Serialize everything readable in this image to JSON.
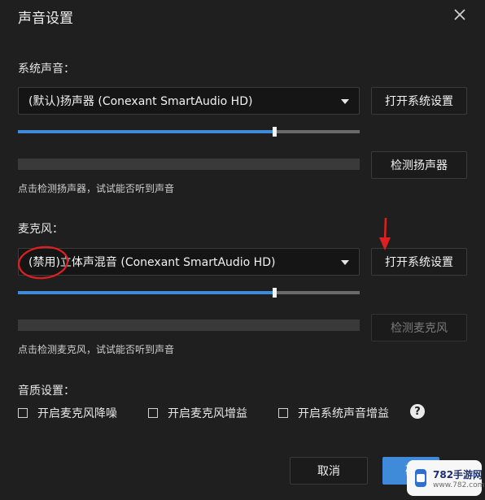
{
  "dialog": {
    "title": "声音设置"
  },
  "speaker": {
    "label": "系统声音：",
    "selected": "(默认)扬声器 (Conexant SmartAudio HD)",
    "open_settings": "打开系统设置",
    "volume": 0.75,
    "test_button": "检测扬声器",
    "hint": "点击检测扬声器，试试能否听到声音"
  },
  "mic": {
    "label": "麦克风：",
    "selected": "(禁用)立体声混音 (Conexant SmartAudio HD)",
    "open_settings": "打开系统设置",
    "volume": 0.75,
    "test_button": "检测麦克风",
    "hint": "点击检测麦克风，试试能否听到声音"
  },
  "quality": {
    "label": "音质设置：",
    "options": [
      {
        "label": "开启麦克风降噪",
        "checked": false
      },
      {
        "label": "开启麦克风增益",
        "checked": false
      },
      {
        "label": "开启系统声音增益",
        "checked": false
      }
    ],
    "help": "?"
  },
  "footer": {
    "cancel": "取消",
    "confirm": "确"
  },
  "watermark": {
    "line1": "782手游网",
    "line2": "www.782.com"
  },
  "colors": {
    "accent": "#3f8bd9",
    "annotation": "#e02020"
  }
}
